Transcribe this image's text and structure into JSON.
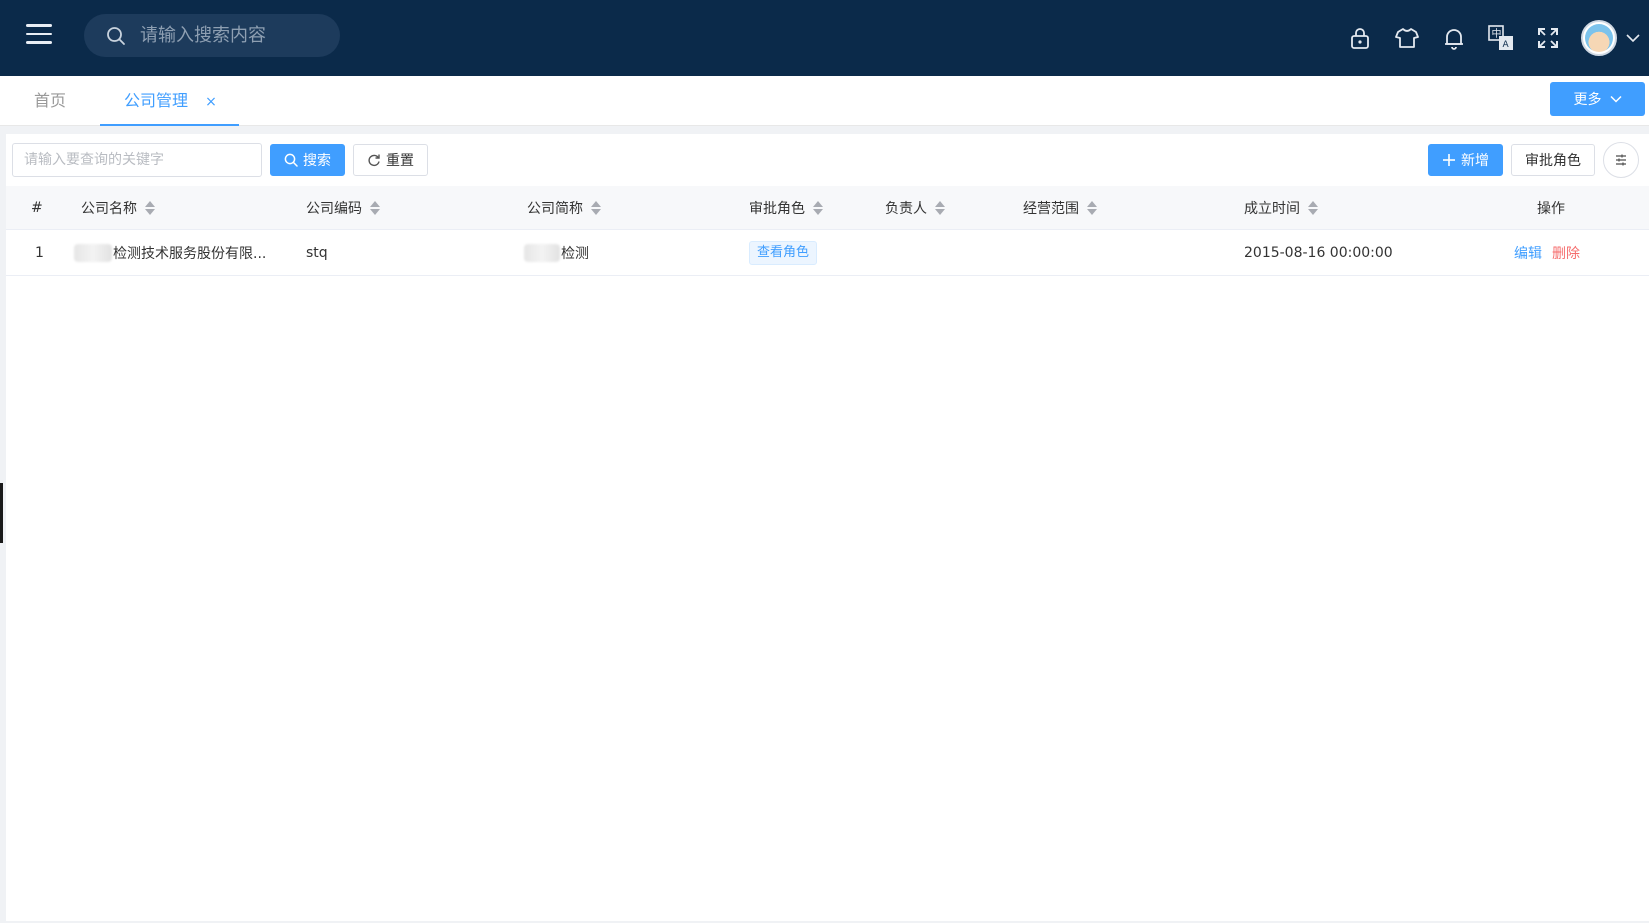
{
  "topbar": {
    "search_placeholder": "请输入搜索内容",
    "icons": [
      "lock-icon",
      "shirt-icon",
      "bell-icon",
      "translate-icon",
      "fullscreen-icon"
    ],
    "bg_color": "#0b2a4a"
  },
  "tabs": [
    {
      "label": "首页",
      "active": false
    },
    {
      "label": "公司管理",
      "active": true,
      "closable": true
    }
  ],
  "tab_close_symbol": "×",
  "more_button": "更多",
  "toolbar": {
    "keyword_placeholder": "请输入要查询的关键字",
    "search_label": "搜索",
    "reset_label": "重置",
    "add_label": "新增",
    "approval_role_label": "审批角色"
  },
  "table": {
    "columns": [
      "#",
      "公司名称",
      "公司编码",
      "公司简称",
      "审批角色",
      "负责人",
      "经营范围",
      "成立时间",
      "操作"
    ],
    "rows": [
      {
        "index": "1",
        "name": "检测技术服务股份有限...",
        "code": "stq",
        "short_name": "检测",
        "approval_role": "查看角色",
        "owner": "",
        "scope": "",
        "established": "2015-08-16 00:00:00",
        "edit": "编辑",
        "delete": "删除"
      }
    ]
  },
  "colors": {
    "primary": "#409eff",
    "danger": "#f56c6c"
  }
}
